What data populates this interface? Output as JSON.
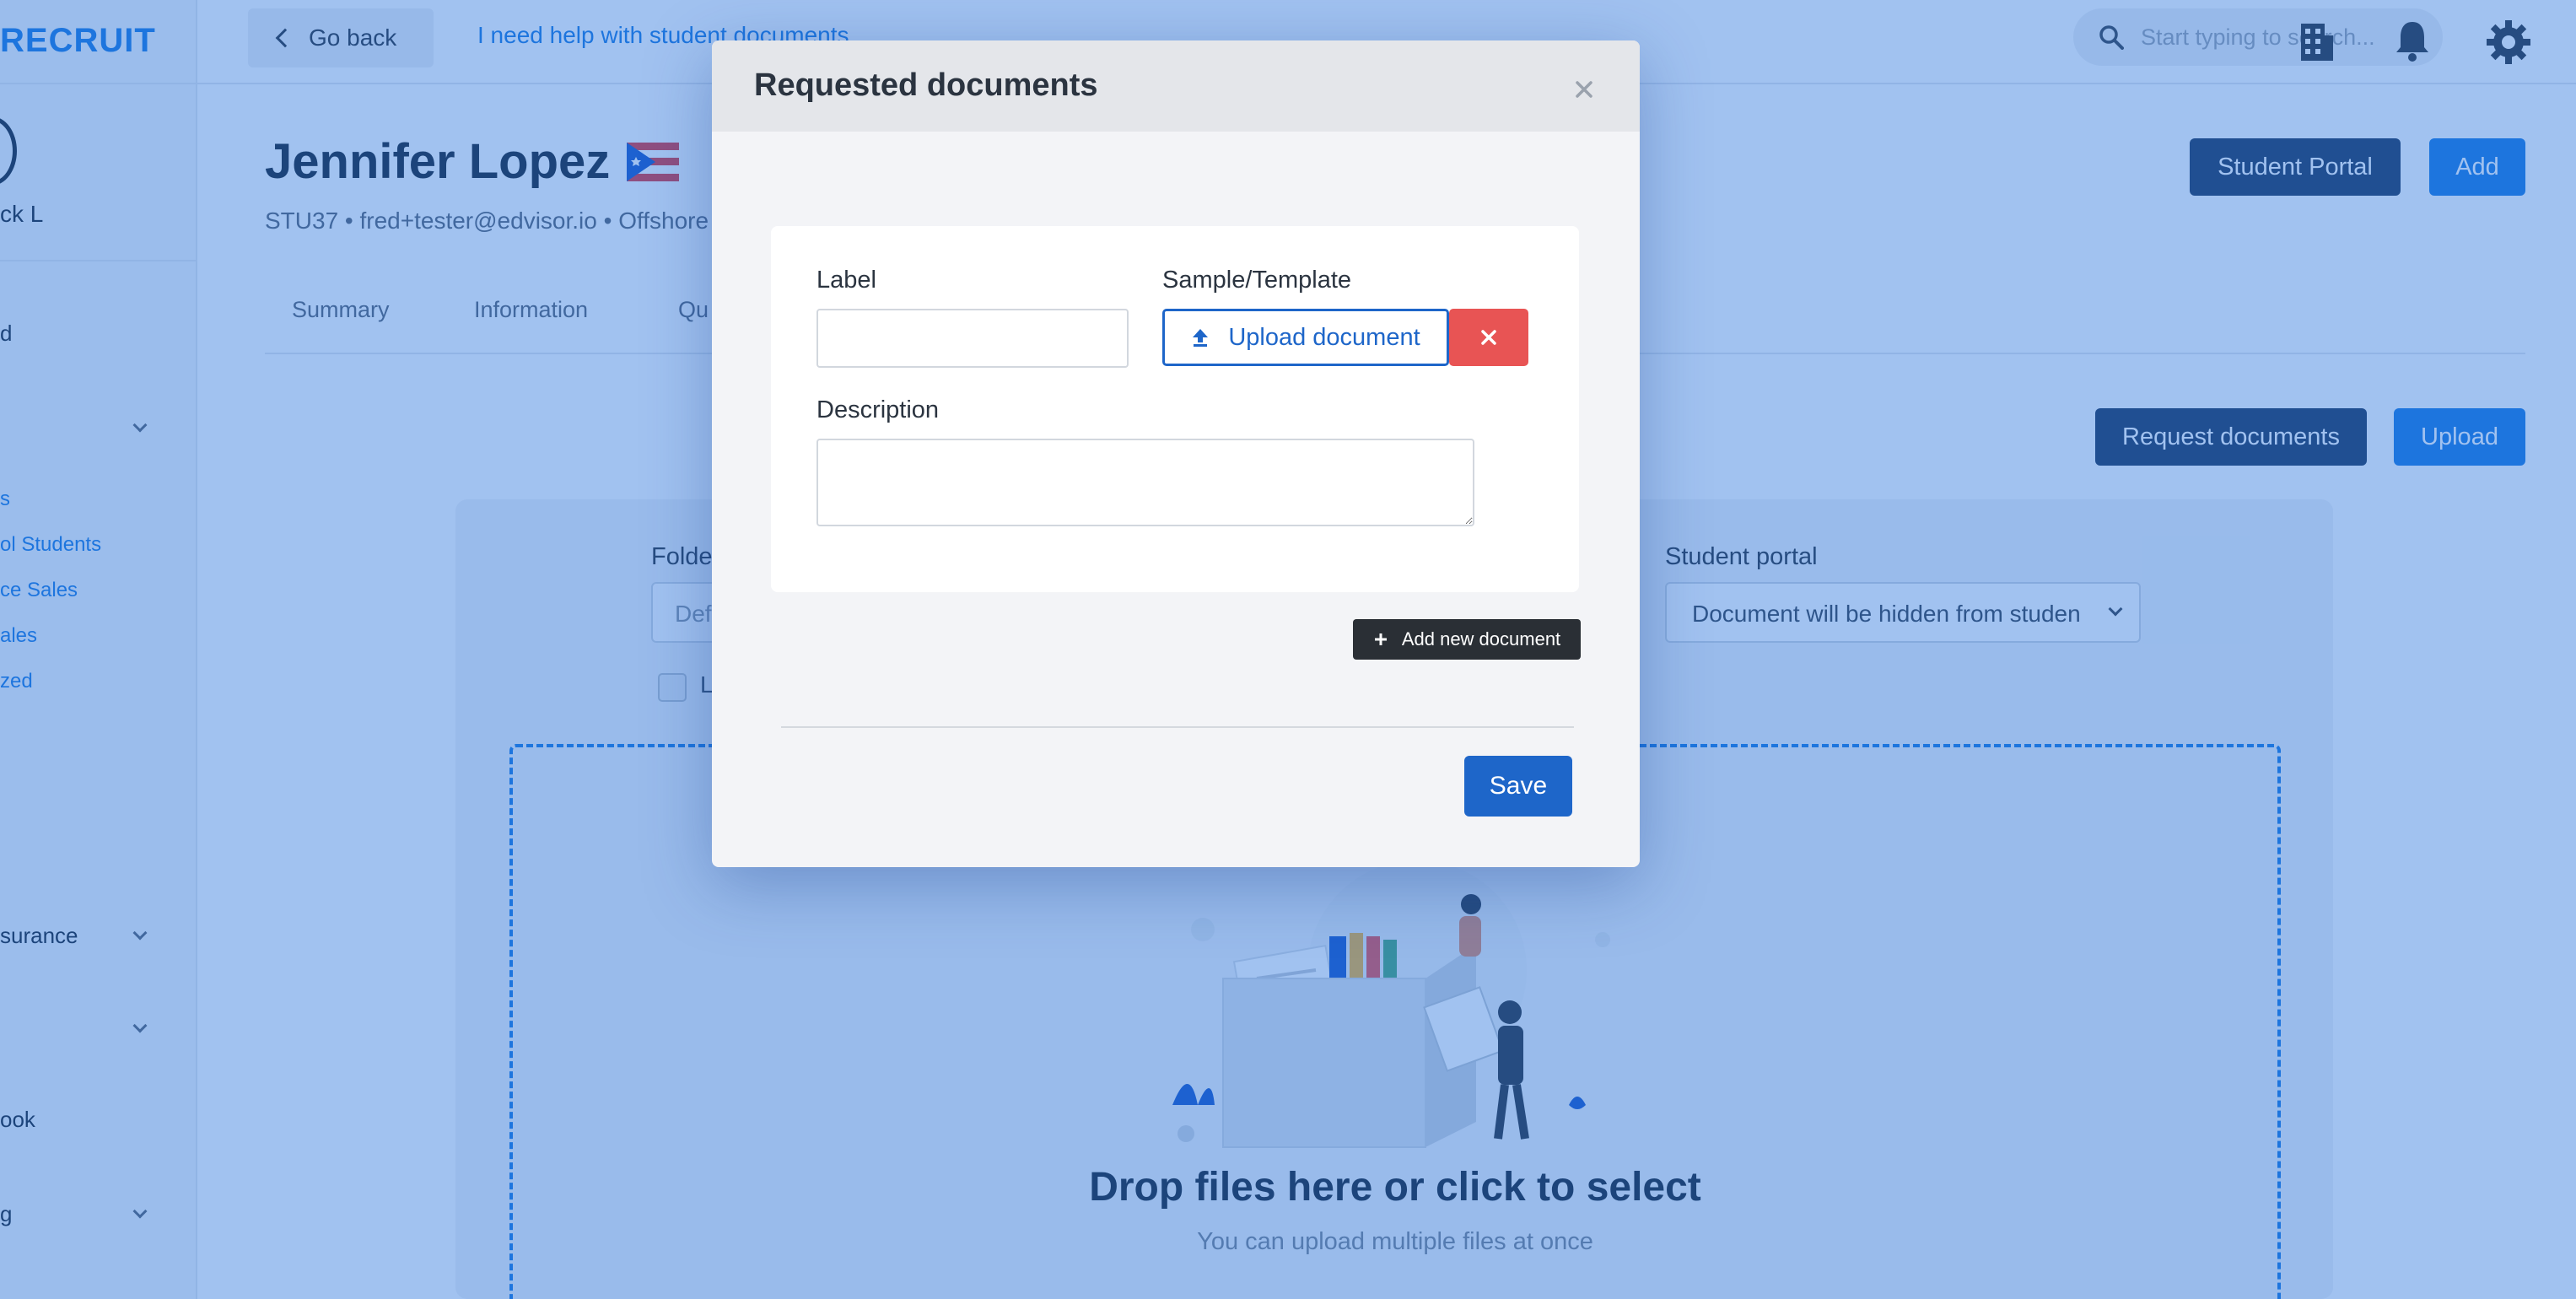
{
  "app": {
    "logo_text": "RECRUIT",
    "user_name": "ck L"
  },
  "sidebar": {
    "items": [
      {
        "label": "d"
      },
      {
        "label": ""
      },
      {
        "label": "surance"
      },
      {
        "label": ""
      },
      {
        "label": "ook"
      },
      {
        "label": "g"
      }
    ],
    "sub_items": [
      {
        "label": "s"
      },
      {
        "label": "ol Students"
      },
      {
        "label": "ce Sales"
      },
      {
        "label": "ales"
      },
      {
        "label": "zed"
      }
    ]
  },
  "topbar": {
    "go_back_label": "Go back",
    "help_link": "I need help with student documents",
    "search_placeholder": "Start typing to search...",
    "icons": [
      "building-icon",
      "bell-icon",
      "gear-icon"
    ]
  },
  "student": {
    "name": "Jennifer Lopez",
    "flag": "puerto-rico-flag-icon",
    "meta": "STU37 • fred+tester@edvisor.io • Offshore",
    "portal_button": "Student Portal",
    "add_button": "Add"
  },
  "tabs": [
    "Summary",
    "Information",
    "Qu"
  ],
  "documents": {
    "request_button": "Request documents",
    "upload_button": "Upload",
    "folder_label": "Folde",
    "folder_value": "Defa",
    "portal_label": "Student portal",
    "portal_value": "Document will be hidden from studen",
    "checkbox_label": "L",
    "drop_title": "Drop files here or click to select",
    "drop_subtitle": "You can upload multiple files at once"
  },
  "modal": {
    "title": "Requested documents",
    "label_field_label": "Label",
    "label_field_value": "",
    "template_label": "Sample/Template",
    "upload_button": "Upload document",
    "description_label": "Description",
    "description_value": "",
    "add_new_button": "Add new document",
    "save_button": "Save"
  },
  "colors": {
    "accent": "#1e66c9",
    "danger": "#e85454",
    "overlay": "#1e6edc",
    "dark_button": "#2a2f35"
  }
}
